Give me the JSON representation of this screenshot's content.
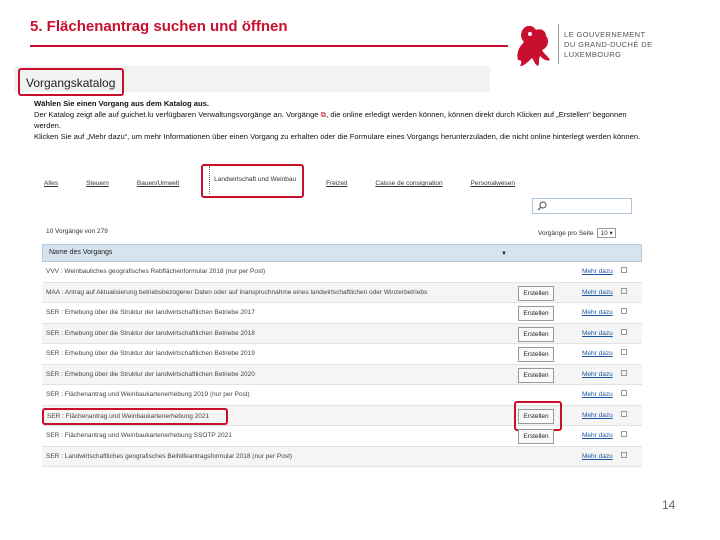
{
  "slide": {
    "title": "5. Flächenantrag suchen und öffnen",
    "page_number": "14",
    "logo_text_line1": "LE GOUVERNEMENT",
    "logo_text_line2": "DU GRAND-DUCHÉ DE LUXEMBOURG"
  },
  "catalog": {
    "title": "Vorgangskatalog",
    "intro_lead": "Wählen Sie einen Vorgang aus dem Katalog aus.",
    "intro_line2a": "Der Katalog zeigt alle auf guichet.lu verfügbaren Verwaltungsvorgänge an. Vorgänge",
    "intro_line2b": ", die online erledigt werden können, können direkt durch Klicken auf „Erstellen“ begonnen werden.",
    "intro_line3": "Klicken Sie auf „Mehr dazu“, um mehr Informationen über einen Vorgang zu erhalten oder die Formulare eines Vorgangs herunterzuladen, die nicht online hinterlegt werden können.",
    "tabs": [
      "Alles",
      "Steuern",
      "Bauen/Umwelt",
      "Landwirtschaft und Weinbau",
      "Freizeit",
      "Caisse de consignation",
      "Personalwesen"
    ],
    "result_count": "10 Vorgänge von 279",
    "per_page_label": "Vorgänge pro Seite",
    "per_page_value": "10",
    "column_header": "Name des Vorgangs",
    "create_label": "Erstellen",
    "more_label": "Mehr dazu",
    "rows": [
      {
        "title": "VVV : Weinbauliches geografisches Rebflächenformular 2018 (nur per Post)",
        "create": false
      },
      {
        "title": "MAA : Antrag auf Aktualisierung betriebsbezogener Daten oder auf Inanspruchnahme eines landwirtschaftlichen oder Winzerbetriebs",
        "create": true
      },
      {
        "title": "SER : Erhebung über die Struktur der landwirtschaftlichen Betriebe 2017",
        "create": true
      },
      {
        "title": "SER : Erhebung über die Struktur der landwirtschaftlichen Betriebe 2018",
        "create": true
      },
      {
        "title": "SER : Erhebung über die Struktur der landwirtschaftlichen Betriebe 2019",
        "create": true
      },
      {
        "title": "SER : Erhebung über die Struktur der landwirtschaftlichen Betriebe 2020",
        "create": true
      },
      {
        "title": "SER : Flächenantrag und Weinbaukartenerhebung 2019 (nur per Post)",
        "create": false
      },
      {
        "title": "SER : Flächenantrag und Weinbaukartenerhebung 2021",
        "create": true
      },
      {
        "title": "SER : Flächenantrag und Weinbaukartenerhebung SSOTP 2021",
        "create": true
      },
      {
        "title": "SER : Landwirtschaftliches geografisches Beihilfeantragsformular 2018 (nur per Post)",
        "create": false
      }
    ]
  },
  "colors": {
    "accent": "#c8102e",
    "link": "#1a56a0",
    "table_header": "#d6e4f0"
  }
}
